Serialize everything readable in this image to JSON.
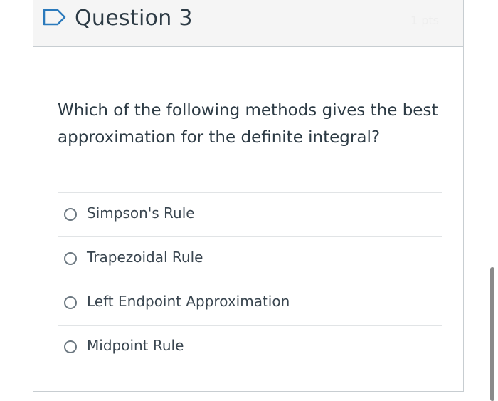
{
  "header": {
    "title": "Question 3",
    "points": "1 pts"
  },
  "question": {
    "text": "Which of the following methods gives the best approximation for the definite integral?"
  },
  "answers": [
    {
      "label": "Simpson's Rule",
      "selected": false
    },
    {
      "label": "Trapezoidal Rule",
      "selected": false
    },
    {
      "label": "Left Endpoint Approximation",
      "selected": false
    },
    {
      "label": "Midpoint Rule",
      "selected": false
    }
  ],
  "icons": {
    "flag": "flag-outline-icon"
  },
  "colors": {
    "accent": "#2b7abc",
    "text": "#2d3b45",
    "border": "#c7cdd1",
    "header_bg": "#f5f5f5"
  }
}
